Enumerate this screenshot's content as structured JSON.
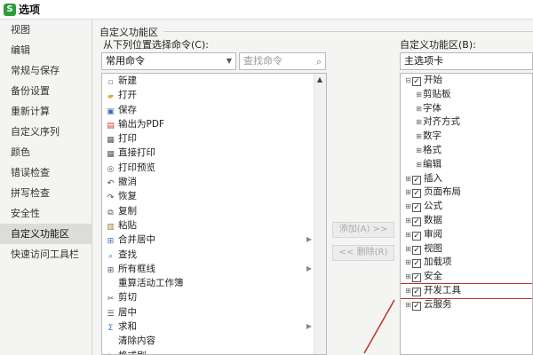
{
  "window": {
    "title": "选项",
    "app_icon_letter": "S"
  },
  "sidebar": {
    "items": [
      {
        "label": "视图"
      },
      {
        "label": "编辑"
      },
      {
        "label": "常规与保存"
      },
      {
        "label": "备份设置"
      },
      {
        "label": "重新计算"
      },
      {
        "label": "自定义序列"
      },
      {
        "label": "颜色"
      },
      {
        "label": "错误检查"
      },
      {
        "label": "拼写检查"
      },
      {
        "label": "安全性"
      },
      {
        "label": "自定义功能区",
        "active": true
      },
      {
        "label": "快速访问工具栏"
      }
    ]
  },
  "main": {
    "section_title": "自定义功能区",
    "left_label": "从下列位置选择命令(C):",
    "right_label": "自定义功能区(B):",
    "left_select": "常用命令",
    "search_placeholder": "查找命令",
    "right_select": "主选项卡",
    "add_button": "添加(A) >>",
    "remove_button": "<< 删除(R)",
    "commands": [
      {
        "label": "新建",
        "icon": "new-icon",
        "glyph": "▫",
        "color": "#777"
      },
      {
        "label": "打开",
        "icon": "open-folder-icon",
        "glyph": "▰",
        "color": "#e8a33b"
      },
      {
        "label": "保存",
        "icon": "save-icon",
        "glyph": "▣",
        "color": "#3d6fb8"
      },
      {
        "label": "输出为PDF",
        "icon": "pdf-icon",
        "glyph": "▤",
        "color": "#d33"
      },
      {
        "label": "打印",
        "icon": "print-icon",
        "glyph": "▦",
        "color": "#555"
      },
      {
        "label": "直接打印",
        "icon": "direct-print-icon",
        "glyph": "▦",
        "color": "#555"
      },
      {
        "label": "打印预览",
        "icon": "print-preview-icon",
        "glyph": "◎",
        "color": "#555"
      },
      {
        "label": "撤消",
        "icon": "undo-icon",
        "glyph": "↶",
        "color": "#444"
      },
      {
        "label": "恢复",
        "icon": "redo-icon",
        "glyph": "↷",
        "color": "#444"
      },
      {
        "label": "复制",
        "icon": "copy-icon",
        "glyph": "⧉",
        "color": "#555"
      },
      {
        "label": "粘贴",
        "icon": "paste-icon",
        "glyph": "▥",
        "color": "#a07a3c"
      },
      {
        "label": "合并居中",
        "icon": "merge-center-icon",
        "glyph": "⊞",
        "color": "#3d6fb8",
        "submenu": true
      },
      {
        "label": "查找",
        "icon": "find-icon",
        "glyph": "⌕",
        "color": "#3d6fb8"
      },
      {
        "label": "所有框线",
        "icon": "all-borders-icon",
        "glyph": "⊞",
        "color": "#555",
        "submenu": true
      },
      {
        "label": "重算活动工作簿",
        "icon": "",
        "glyph": "",
        "color": "#555"
      },
      {
        "label": "剪切",
        "icon": "cut-icon",
        "glyph": "✂",
        "color": "#555"
      },
      {
        "label": "居中",
        "icon": "align-center-icon",
        "glyph": "☰",
        "color": "#555"
      },
      {
        "label": "求和",
        "icon": "sum-icon",
        "glyph": "Σ",
        "color": "#3d6fb8",
        "submenu": true
      },
      {
        "label": "清除内容",
        "icon": "",
        "glyph": "",
        "color": "#555"
      },
      {
        "label": "格式刷",
        "icon": "format-painter-icon",
        "glyph": "✎",
        "color": "#a07a3c"
      }
    ],
    "tabs": [
      {
        "label": "开始",
        "level": 0,
        "expander": "⊟",
        "checked": true
      },
      {
        "label": "剪贴板",
        "level": 1,
        "expander": "⊞"
      },
      {
        "label": "字体",
        "level": 1,
        "expander": "⊞"
      },
      {
        "label": "对齐方式",
        "level": 1,
        "expander": "⊞"
      },
      {
        "label": "数字",
        "level": 1,
        "expander": "⊞"
      },
      {
        "label": "格式",
        "level": 1,
        "expander": "⊞"
      },
      {
        "label": "编辑",
        "level": 1,
        "expander": "⊞"
      },
      {
        "label": "插入",
        "level": 0,
        "expander": "⊞",
        "checked": true
      },
      {
        "label": "页面布局",
        "level": 0,
        "expander": "⊞",
        "checked": true
      },
      {
        "label": "公式",
        "level": 0,
        "expander": "⊞",
        "checked": true
      },
      {
        "label": "数据",
        "level": 0,
        "expander": "⊞",
        "checked": true
      },
      {
        "label": "审阅",
        "level": 0,
        "expander": "⊞",
        "checked": true
      },
      {
        "label": "视图",
        "level": 0,
        "expander": "⊞",
        "checked": true
      },
      {
        "label": "加载项",
        "level": 0,
        "expander": "⊞",
        "checked": true
      },
      {
        "label": "安全",
        "level": 0,
        "expander": "⊞",
        "checked": true
      },
      {
        "label": "开发工具",
        "level": 0,
        "expander": "⊞",
        "checked": true,
        "highlight": true
      },
      {
        "label": "云服务",
        "level": 0,
        "expander": "⊞",
        "checked": true
      }
    ],
    "highlight_color": "#b5352b"
  }
}
